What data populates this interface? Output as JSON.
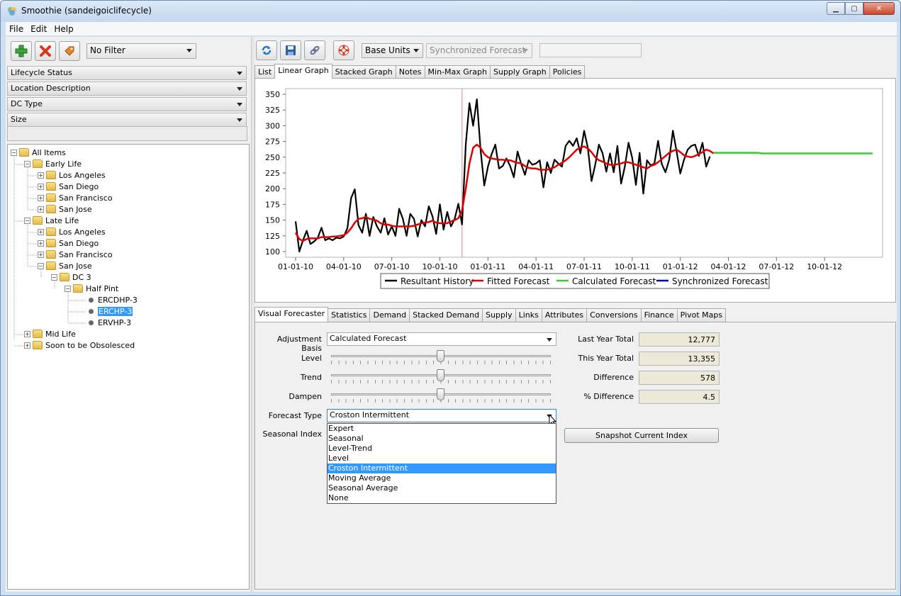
{
  "window": {
    "title": "Smoothie (sandeigoiclifecycle)"
  },
  "menu": [
    "File",
    "Edit",
    "Help"
  ],
  "left": {
    "filter_value": "No Filter",
    "filters": [
      "Lifecycle Status",
      "Location Description",
      "DC Type",
      "Size"
    ],
    "tree": {
      "root": "All Items",
      "early_life": "Early Life",
      "early_children": [
        "Los Angeles",
        "San Diego",
        "San Francisco",
        "San Jose"
      ],
      "late_life": "Late Life",
      "late_children": [
        "Los Angeles",
        "San Diego",
        "San Francisco",
        "San Jose"
      ],
      "dc3": "DC 3",
      "half_pint": "Half Pint",
      "items": [
        "ERCDHP-3",
        "ERCHP-3",
        "ERVHP-3"
      ],
      "mid_life": "Mid Life",
      "obsolesced": "Soon to be Obsolesced"
    }
  },
  "toolbar": {
    "units": "Base Units",
    "forecast_select": "Synchronized Forecast",
    "search_value": ""
  },
  "top_tabs": [
    "List",
    "Linear Graph",
    "Stacked Graph",
    "Notes",
    "Min-Max Graph",
    "Supply Graph",
    "Policies"
  ],
  "chart_data": {
    "type": "line",
    "ylim": [
      100,
      350
    ],
    "yticks": [
      100,
      125,
      150,
      175,
      200,
      225,
      250,
      275,
      300,
      325,
      350
    ],
    "xtick_labels": [
      "01-01-10",
      "04-01-10",
      "07-01-10",
      "10-01-10",
      "01-01-11",
      "04-01-11",
      "07-01-11",
      "10-01-11",
      "01-01-12",
      "04-01-12",
      "07-01-12",
      "10-01-12"
    ],
    "x_range_weeks": [
      0,
      156
    ],
    "marker_week": 45,
    "legend_position": "bottom",
    "series": [
      {
        "name": "Resultant History",
        "color": "#000000",
        "start_week": 0,
        "values": [
          148,
          100,
          118,
          133,
          112,
          116,
          122,
          138,
          118,
          121,
          118,
          122,
          121,
          124,
          137,
          185,
          199,
          142,
          130,
          160,
          125,
          155,
          140,
          130,
          153,
          127,
          140,
          125,
          168,
          152,
          125,
          160,
          152,
          124,
          150,
          140,
          172,
          156,
          128,
          175,
          135,
          163,
          140,
          152,
          176,
          143,
          270,
          336,
          300,
          342,
          262,
          205,
          235,
          255,
          270,
          232,
          236,
          248,
          236,
          218,
          259,
          239,
          222,
          245,
          238,
          240,
          245,
          202,
          242,
          225,
          246,
          240,
          235,
          268,
          276,
          268,
          280,
          256,
          292,
          265,
          212,
          238,
          270,
          256,
          227,
          256,
          226,
          268,
          208,
          235,
          273,
          249,
          206,
          257,
          192,
          245,
          237,
          240,
          276,
          239,
          226,
          246,
          292,
          259,
          224,
          246,
          262,
          268,
          270,
          252,
          273,
          235,
          251
        ]
      },
      {
        "name": "Fitted Forecast",
        "color": "#e00000",
        "start_week": 0,
        "values": [
          130,
          120,
          117,
          120,
          121,
          121,
          121,
          123,
          123,
          123,
          124,
          124,
          125,
          126,
          130,
          137,
          146,
          152,
          153,
          155,
          152,
          151,
          149,
          145,
          143,
          143,
          141,
          140,
          140,
          140,
          140,
          140,
          141,
          143,
          145,
          146,
          147,
          149,
          146,
          145,
          145,
          145,
          148,
          150,
          153,
          165,
          200,
          240,
          265,
          270,
          265,
          255,
          250,
          248,
          247,
          246,
          246,
          245,
          245,
          243,
          241,
          240,
          236,
          233,
          232,
          232,
          230,
          230,
          230,
          232,
          234,
          238,
          241,
          245,
          250,
          256,
          262,
          265,
          267,
          264,
          258,
          250,
          245,
          243,
          240,
          238,
          237,
          239,
          240,
          242,
          242,
          240,
          238,
          236,
          234,
          232,
          236,
          238,
          242,
          247,
          252,
          257,
          260,
          262,
          258,
          253,
          251,
          250,
          252,
          255,
          258,
          262,
          260,
          256
        ]
      },
      {
        "name": "Calculated Forecast",
        "color": "#33cc33",
        "start_week": 113,
        "values": [
          257,
          257,
          257,
          257,
          257,
          257,
          257,
          257,
          257,
          257,
          257,
          257,
          257,
          256,
          256,
          256,
          256,
          256,
          256,
          256,
          256,
          256,
          256,
          256,
          256,
          256,
          256,
          256,
          256,
          256,
          256,
          256,
          256,
          256,
          256,
          256,
          256,
          256,
          256,
          256,
          256,
          256,
          256,
          256
        ]
      },
      {
        "name": "Synchronized Forecast",
        "color": "#0000cc",
        "start_week": 0,
        "values": []
      }
    ]
  },
  "bottom_tabs": [
    "Visual Forecaster",
    "Statistics",
    "Demand",
    "Stacked Demand",
    "Supply",
    "Links",
    "Attributes",
    "Conversions",
    "Finance",
    "Pivot Maps"
  ],
  "forecaster": {
    "adjustment_basis_label": "Adjustment Basis",
    "adjustment_basis_value": "Calculated Forecast",
    "level_label": "Level",
    "trend_label": "Trend",
    "dampen_label": "Dampen",
    "level_value_pct": 50,
    "trend_value_pct": 50,
    "dampen_value_pct": 50,
    "forecast_type_label": "Forecast Type",
    "forecast_type_value": "Croston Intermittent",
    "seasonal_index_label": "Seasonal Index",
    "forecast_options": [
      "Expert",
      "Seasonal",
      "Level-Trend",
      "Level",
      "Croston Intermittent",
      "Moving Average",
      "Seasonal Average",
      "None"
    ],
    "selected_option_index": 4,
    "snapshot_button": "Snapshot Current Index"
  },
  "stats": {
    "last_year_label": "Last Year Total",
    "last_year_value": "12,777",
    "this_year_label": "This Year Total",
    "this_year_value": "13,355",
    "difference_label": "Difference",
    "difference_value": "578",
    "pct_difference_label": "% Difference",
    "pct_difference_value": "4.5"
  }
}
